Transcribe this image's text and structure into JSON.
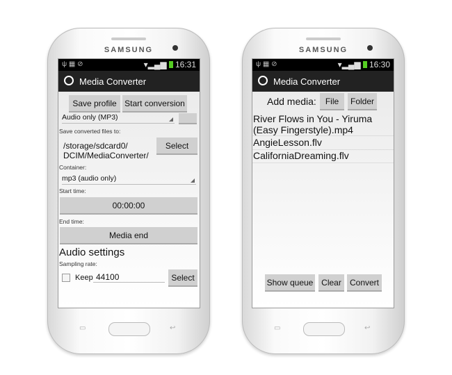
{
  "device_brand": "SAMSUNG",
  "app_title": "Media Converter",
  "left": {
    "status_time": "16:31",
    "save_profile": "Save profile",
    "start_conversion": "Start conversion",
    "profile_value": "Audio only (MP3)",
    "save_to_label": "Save converted files to:",
    "path_line1": "/storage/sdcard0/",
    "path_line2": "DCIM/MediaConverter/",
    "select": "Select",
    "container_label": "Container:",
    "container_value": "mp3 (audio only)",
    "start_label": "Start time:",
    "start_value": "00:00:00",
    "end_label": "End time:",
    "end_value": "Media end",
    "audio_heading": "Audio settings",
    "sampling_label": "Sampling rate:",
    "keep_label": "Keep",
    "keep_checked": false,
    "sampling_value": "44100",
    "sampling_select": "Select"
  },
  "right": {
    "status_time": "16:30",
    "add_media": "Add media:",
    "file": "File",
    "folder": "Folder",
    "items": [
      "River Flows in You - Yiruma (Easy Fingerstyle).mp4",
      "AngieLesson.flv",
      "CaliforniaDreaming.flv"
    ],
    "show_queue": "Show queue",
    "clear": "Clear",
    "convert": "Convert"
  },
  "colors": {
    "action_bar": "#222222",
    "button": "#d0d0d0",
    "battery": "#55cc22"
  }
}
